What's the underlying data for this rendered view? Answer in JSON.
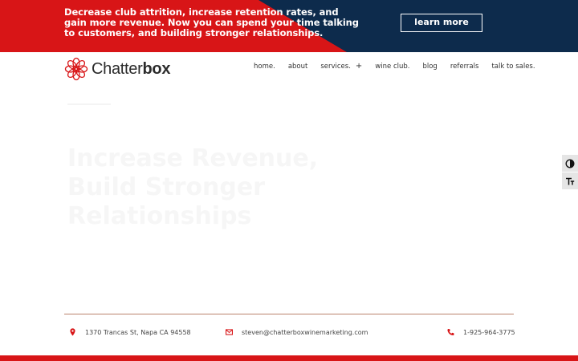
{
  "banner": {
    "text": "Decrease club attrition, increase retention rates, and gain more revenue. Now you can spend your time talking to customers, and building stronger relationships.",
    "button_label": "learn more"
  },
  "header": {
    "logo_text_light": "Chatter",
    "logo_text_bold": "box",
    "nav": [
      {
        "label": "home."
      },
      {
        "label": "about"
      },
      {
        "label": "services."
      },
      {
        "label": "wine club."
      },
      {
        "label": "blog"
      },
      {
        "label": "referrals"
      },
      {
        "label": "talk to sales."
      }
    ],
    "services_expand": "+"
  },
  "hero": {
    "title": "Increase Revenue, Build Stronger Relationships"
  },
  "footer": {
    "address": "1370 Trancas St, Napa CA 94558",
    "email": "steven@chatterboxwinemarketing.com",
    "phone": "1-925-964-3775"
  },
  "colors": {
    "brand_red": "#d81517",
    "navy": "#0d2b4c"
  },
  "icons": {
    "contrast": "contrast-icon",
    "font_size": "font-size-icon",
    "location": "location-pin-icon",
    "email": "email-icon",
    "phone": "phone-icon"
  }
}
